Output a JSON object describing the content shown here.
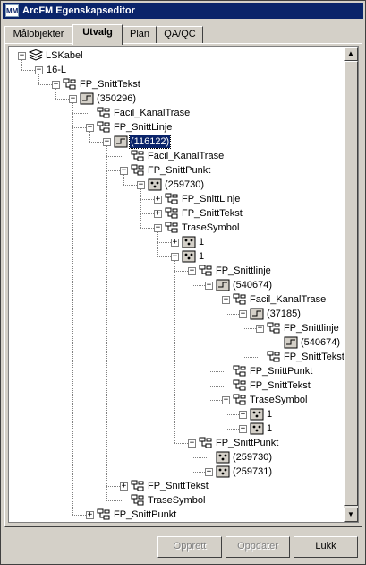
{
  "window": {
    "title": "ArcFM Egenskapseditor",
    "icon_text": "MM"
  },
  "tabs": [
    {
      "label": "Målobjekter",
      "active": false
    },
    {
      "label": "Utvalg",
      "active": true
    },
    {
      "label": "Plan",
      "active": false
    },
    {
      "label": "QA/QC",
      "active": false
    }
  ],
  "tree": {
    "nodes": [
      {
        "label": "LSKabel",
        "icon": "stack-icon",
        "expander": "minus",
        "depth": 0
      },
      {
        "label": "16-L",
        "icon": "none",
        "expander": "minus",
        "depth": 1
      },
      {
        "label": "FP_SnittTekst",
        "icon": "relationship-icon",
        "expander": "minus",
        "depth": 2
      },
      {
        "label": "(350296)",
        "icon": "feature-icon",
        "expander": "minus",
        "depth": 3
      },
      {
        "label": "Facil_KanalTrase",
        "icon": "relationship-icon",
        "expander": "none",
        "depth": 4
      },
      {
        "label": "FP_SnittLinje",
        "icon": "relationship-icon",
        "expander": "minus",
        "depth": 4
      },
      {
        "label": "(116122)",
        "icon": "feature-icon",
        "expander": "minus",
        "depth": 5,
        "selected": true
      },
      {
        "label": "Facil_KanalTrase",
        "icon": "relationship-icon",
        "expander": "none",
        "depth": 6
      },
      {
        "label": "FP_SnittPunkt",
        "icon": "relationship-icon",
        "expander": "minus",
        "depth": 6
      },
      {
        "label": "(259730)",
        "icon": "point-icon",
        "expander": "minus",
        "depth": 7
      },
      {
        "label": "FP_SnittLinje",
        "icon": "relationship-icon",
        "expander": "plus",
        "depth": 8
      },
      {
        "label": "FP_SnittTekst",
        "icon": "relationship-icon",
        "expander": "plus",
        "depth": 8
      },
      {
        "label": "TraseSymbol",
        "icon": "relationship-icon",
        "expander": "minus",
        "depth": 8
      },
      {
        "label": "1",
        "icon": "point-icon",
        "expander": "plus",
        "depth": 9
      },
      {
        "label": "1",
        "icon": "point-icon",
        "expander": "minus",
        "depth": 9
      },
      {
        "label": "FP_Snittlinje",
        "icon": "relationship-icon",
        "expander": "minus",
        "depth": 10
      },
      {
        "label": "(540674)",
        "icon": "feature-icon",
        "expander": "minus",
        "depth": 11
      },
      {
        "label": "Facil_KanalTrase",
        "icon": "relationship-icon",
        "expander": "minus",
        "depth": 12
      },
      {
        "label": "(37185)",
        "icon": "feature-icon",
        "expander": "minus",
        "depth": 13
      },
      {
        "label": "FP_Snittlinje",
        "icon": "relationship-icon",
        "expander": "minus",
        "depth": 14
      },
      {
        "label": "(540674)",
        "icon": "feature-icon",
        "expander": "none",
        "depth": 15
      },
      {
        "label": "FP_SnittTekst",
        "icon": "relationship-icon",
        "expander": "none",
        "depth": 14
      },
      {
        "label": "FP_SnittPunkt",
        "icon": "relationship-icon",
        "expander": "none",
        "depth": 12
      },
      {
        "label": "FP_SnittTekst",
        "icon": "relationship-icon",
        "expander": "none",
        "depth": 12
      },
      {
        "label": "TraseSymbol",
        "icon": "relationship-icon",
        "expander": "minus",
        "depth": 12
      },
      {
        "label": "1",
        "icon": "point-icon",
        "expander": "plus",
        "depth": 13
      },
      {
        "label": "1",
        "icon": "point-icon",
        "expander": "plus",
        "depth": 13
      },
      {
        "label": "FP_SnittPunkt",
        "icon": "relationship-icon",
        "expander": "minus",
        "depth": 10
      },
      {
        "label": "(259730)",
        "icon": "point-icon",
        "expander": "none",
        "depth": 11
      },
      {
        "label": "(259731)",
        "icon": "point-icon",
        "expander": "plus",
        "depth": 11
      },
      {
        "label": "FP_SnittTekst",
        "icon": "relationship-icon",
        "expander": "plus",
        "depth": 6
      },
      {
        "label": "TraseSymbol",
        "icon": "relationship-icon",
        "expander": "none",
        "depth": 6
      },
      {
        "label": "FP_SnittPunkt",
        "icon": "relationship-icon",
        "expander": "plus",
        "depth": 4
      }
    ]
  },
  "buttons": {
    "opprett": {
      "label": "Opprett",
      "enabled": false
    },
    "oppdater": {
      "label": "Oppdater",
      "enabled": false
    },
    "lukk": {
      "label": "Lukk",
      "enabled": true
    }
  }
}
